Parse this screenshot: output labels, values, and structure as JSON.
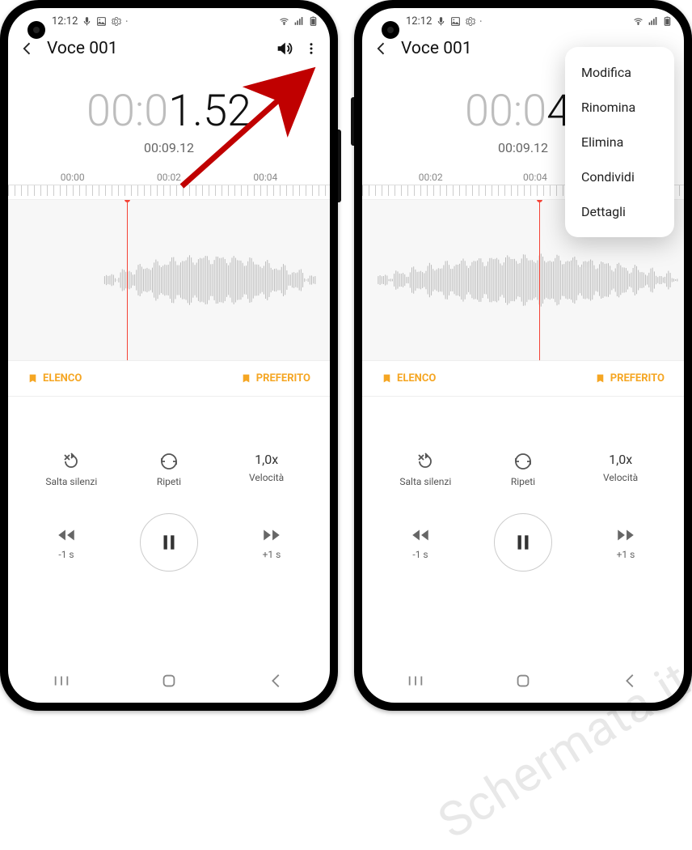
{
  "status": {
    "time": "12:12"
  },
  "app": {
    "title": "Voce 001"
  },
  "left": {
    "timer_dim": "00:0",
    "timer_bold": "1.52",
    "duration": "00:09.12",
    "ticks": [
      "00:00",
      "00:02",
      "00:04"
    ],
    "playhead_pct": 37
  },
  "right": {
    "timer_dim": "00:0",
    "timer_bold": "4.",
    "duration": "00:09.12",
    "ticks": [
      "00:02",
      "00:04"
    ],
    "playhead_pct": 55
  },
  "tags": {
    "left": "ELENCO",
    "right": "PREFERITO"
  },
  "controls": {
    "skip_silence": "Salta silenzi",
    "repeat": "Ripeti",
    "speed_value": "1,0x",
    "speed_label": "Velocità"
  },
  "transport": {
    "back": "-1 s",
    "fwd": "+1 s"
  },
  "menu": {
    "items": [
      "Modifica",
      "Rinomina",
      "Elimina",
      "Condividi",
      "Dettagli"
    ]
  },
  "watermark": "Schermata.it"
}
